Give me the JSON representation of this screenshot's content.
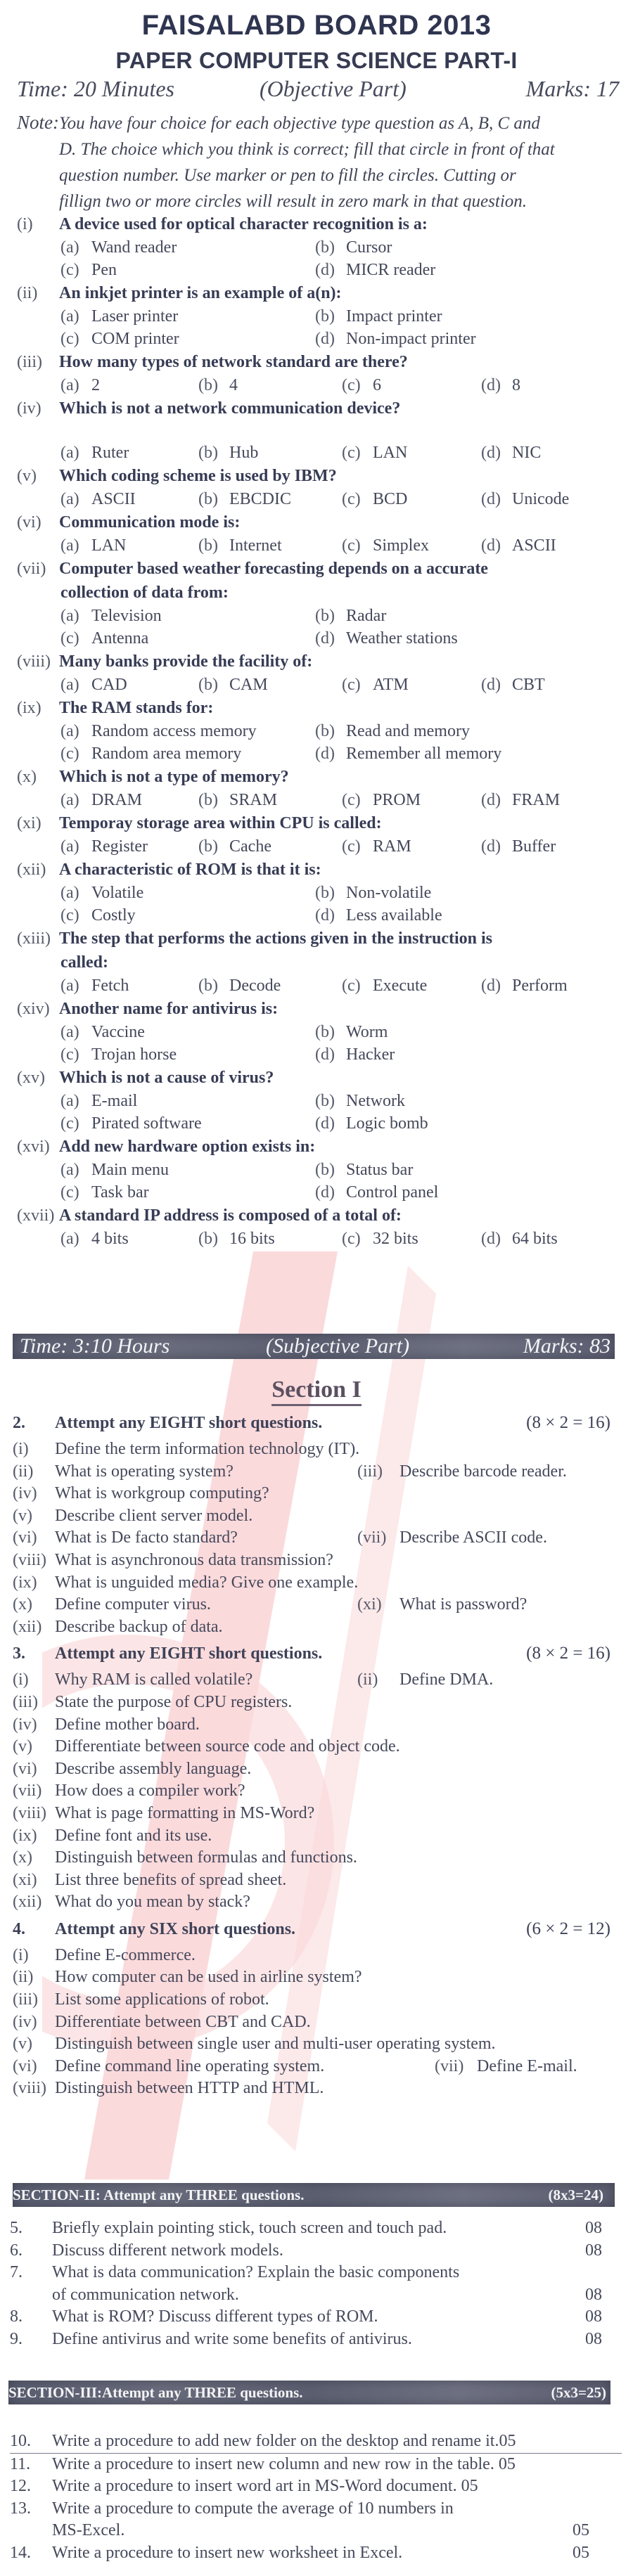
{
  "header": {
    "board": "FAISALABD BOARD 2013",
    "paper": "PAPER COMPUTER SCIENCE PART-I",
    "objective": {
      "time": "Time: 20 Minutes",
      "part": "(Objective Part)",
      "marks": "Marks: 17"
    },
    "note_label": "Note:",
    "note_lines": [
      "You have four choice for each objective type question as A, B, C and",
      "D. The choice which you think is correct; fill that circle in front of that",
      "question number. Use marker or pen to fill the circles. Cutting or",
      "fillign two or more circles will result in zero mark in that question."
    ]
  },
  "mcqs": [
    {
      "num": "(i)",
      "q": [
        "A device used for optical character recognition is a:"
      ],
      "layout": "2col",
      "options": [
        [
          "(a)",
          "Wand reader"
        ],
        [
          "(b)",
          "Cursor"
        ],
        [
          "(c)",
          "Pen"
        ],
        [
          "(d)",
          "MICR reader"
        ]
      ]
    },
    {
      "num": "(ii)",
      "q": [
        "An inkjet printer is an example of a(n):"
      ],
      "layout": "2col",
      "options": [
        [
          "(a)",
          "Laser printer"
        ],
        [
          "(b)",
          "Impact printer"
        ],
        [
          "(c)",
          "COM printer"
        ],
        [
          "(d)",
          "Non-impact printer"
        ]
      ]
    },
    {
      "num": "(iii)",
      "q": [
        "How many types of network standard are there?"
      ],
      "layout": "4col",
      "options": [
        [
          "(a)",
          "2"
        ],
        [
          "(b)",
          "4"
        ],
        [
          "(c)",
          "6"
        ],
        [
          "(d)",
          "8"
        ]
      ]
    },
    {
      "num": "(iv)",
      "q": [
        "Which is not a network communication device?"
      ],
      "layout": "4col",
      "gap": true,
      "options": [
        [
          "(a)",
          "Ruter"
        ],
        [
          "(b)",
          "Hub"
        ],
        [
          "(c)",
          "LAN"
        ],
        [
          "(d)",
          "NIC"
        ]
      ]
    },
    {
      "num": "(v)",
      "q": [
        "Which coding scheme is used by IBM?"
      ],
      "layout": "4col",
      "options": [
        [
          "(a)",
          "ASCII"
        ],
        [
          "(b)",
          "EBCDIC"
        ],
        [
          "(c)",
          "BCD"
        ],
        [
          "(d)",
          "Unicode"
        ]
      ]
    },
    {
      "num": "(vi)",
      "q": [
        "Communication mode is:"
      ],
      "layout": "4col",
      "options": [
        [
          "(a)",
          "LAN"
        ],
        [
          "(b)",
          "Internet"
        ],
        [
          "(c)",
          "Simplex"
        ],
        [
          "(d)",
          "ASCII"
        ]
      ]
    },
    {
      "num": "(vii)",
      "q": [
        "Computer based weather forecasting depends on a accurate",
        "collection of data from:"
      ],
      "layout": "2col",
      "options": [
        [
          "(a)",
          "Television"
        ],
        [
          "(b)",
          "Radar"
        ],
        [
          "(c)",
          "Antenna"
        ],
        [
          "(d)",
          "Weather stations"
        ]
      ]
    },
    {
      "num": "(viii)",
      "q": [
        "Many banks provide the facility of:"
      ],
      "layout": "4col",
      "options": [
        [
          "(a)",
          "CAD"
        ],
        [
          "(b)",
          "CAM"
        ],
        [
          "(c)",
          "ATM"
        ],
        [
          "(d)",
          "CBT"
        ]
      ]
    },
    {
      "num": "(ix)",
      "q": [
        "The RAM stands for:"
      ],
      "layout": "2col",
      "options": [
        [
          "(a)",
          "Random access memory"
        ],
        [
          "(b)",
          "Read and memory"
        ],
        [
          "(c)",
          "Random area memory"
        ],
        [
          "(d)",
          "Remember all memory"
        ]
      ]
    },
    {
      "num": "(x)",
      "q": [
        "Which is not a type of memory?"
      ],
      "layout": "4col",
      "options": [
        [
          "(a)",
          "DRAM"
        ],
        [
          "(b)",
          "SRAM"
        ],
        [
          "(c)",
          "PROM"
        ],
        [
          "(d)",
          "FRAM"
        ]
      ]
    },
    {
      "num": "(xi)",
      "q": [
        "Temporay storage area within CPU is called:"
      ],
      "layout": "4col",
      "options": [
        [
          "(a)",
          "Register"
        ],
        [
          "(b)",
          "Cache"
        ],
        [
          "(c)",
          "RAM"
        ],
        [
          "(d)",
          "Buffer"
        ]
      ]
    },
    {
      "num": "(xii)",
      "q": [
        "A characteristic of ROM is that it is:"
      ],
      "layout": "2col",
      "options": [
        [
          "(a)",
          "Volatile"
        ],
        [
          "(b)",
          "Non-volatile"
        ],
        [
          "(c)",
          "Costly"
        ],
        [
          "(d)",
          "Less available"
        ]
      ]
    },
    {
      "num": "(xiii)",
      "q": [
        "The step that performs the actions given in the instruction is",
        "called:"
      ],
      "layout": "4col",
      "options": [
        [
          "(a)",
          "Fetch"
        ],
        [
          "(b)",
          "Decode"
        ],
        [
          "(c)",
          "Execute"
        ],
        [
          "(d)",
          "Perform"
        ]
      ]
    },
    {
      "num": "(xiv)",
      "q": [
        "Another name for antivirus is:"
      ],
      "layout": "2col",
      "options": [
        [
          "(a)",
          "Vaccine"
        ],
        [
          "(b)",
          "Worm"
        ],
        [
          "(c)",
          "Trojan horse"
        ],
        [
          "(d)",
          "Hacker"
        ]
      ]
    },
    {
      "num": "(xv)",
      "q": [
        "Which is not a cause of virus?"
      ],
      "layout": "2col",
      "options": [
        [
          "(a)",
          "E-mail"
        ],
        [
          "(b)",
          "Network"
        ],
        [
          "(c)",
          "Pirated software"
        ],
        [
          "(d)",
          "Logic bomb"
        ]
      ]
    },
    {
      "num": "(xvi)",
      "q": [
        "Add new hardware option exists in:"
      ],
      "layout": "2col",
      "options": [
        [
          "(a)",
          "Main menu"
        ],
        [
          "(b)",
          "Status bar"
        ],
        [
          "(c)",
          "Task bar"
        ],
        [
          "(d)",
          "Control panel"
        ]
      ]
    },
    {
      "num": "(xvii)",
      "q": [
        "A standard IP address is composed of a total of:"
      ],
      "layout": "4col",
      "options": [
        [
          "(a)",
          "4 bits"
        ],
        [
          "(b)",
          "16 bits"
        ],
        [
          "(c)",
          "32 bits"
        ],
        [
          "(d)",
          "64 bits"
        ]
      ]
    }
  ],
  "subjective": {
    "time": "Time: 3:10 Hours",
    "part": "(Subjective Part)",
    "marks": "Marks: 83",
    "section1_title": "Section I",
    "groups": [
      {
        "num": "2.",
        "title": "Attempt any EIGHT short questions.",
        "marks": "(8 × 2 = 16)",
        "rows": [
          [
            [
              "(i)",
              "Define the term information technology (IT)."
            ]
          ],
          [
            [
              "(ii)",
              "What is operating system?"
            ],
            [
              "(iii)",
              "Describe barcode reader."
            ]
          ],
          [
            [
              "(iv)",
              "What is workgroup computing?"
            ]
          ],
          [
            [
              "(v)",
              "Describe client server model."
            ]
          ],
          [
            [
              "(vi)",
              "What is De facto standard?"
            ],
            [
              "(vii)",
              "Describe ASCII code."
            ]
          ],
          [
            [
              "(viii)",
              "What is asynchronous data transmission?"
            ]
          ],
          [
            [
              "(ix)",
              "What is unguided media? Give one example."
            ]
          ],
          [
            [
              "(x)",
              "Define computer virus."
            ],
            [
              "(xi)",
              "What is password?"
            ]
          ],
          [
            [
              "(xii)",
              "Describe backup of data."
            ]
          ]
        ]
      },
      {
        "num": "3.",
        "title": "Attempt any EIGHT short questions.",
        "marks": "(8 × 2 = 16)",
        "rows": [
          [
            [
              "(i)",
              "Why RAM is called volatile?"
            ],
            [
              "(ii)",
              "Define DMA."
            ]
          ],
          [
            [
              "(iii)",
              "State the purpose of CPU registers."
            ]
          ],
          [
            [
              "(iv)",
              "Define mother board."
            ]
          ],
          [
            [
              "(v)",
              "Differentiate between source code and object code."
            ]
          ],
          [
            [
              "(vi)",
              "Describe assembly language."
            ]
          ],
          [
            [
              "(vii)",
              "How does a compiler work?"
            ]
          ],
          [
            [
              "(viii)",
              "What is page formatting in MS-Word?"
            ]
          ],
          [
            [
              "(ix)",
              "Define font and its use."
            ]
          ],
          [
            [
              "(x)",
              "Distinguish between formulas and functions."
            ]
          ],
          [
            [
              "(xi)",
              "List three benefits of spread sheet."
            ]
          ],
          [
            [
              "(xii)",
              "What do you mean by stack?"
            ]
          ]
        ]
      },
      {
        "num": "4.",
        "title": "Attempt any  SIX  short questions.",
        "marks": "(6 × 2 = 12)",
        "rows": [
          [
            [
              "(i)",
              "Define E-commerce."
            ]
          ],
          [
            [
              "(ii)",
              "How computer can be used in airline system?"
            ]
          ],
          [
            [
              "(iii)",
              "List some applications of robot."
            ]
          ],
          [
            [
              "(iv)",
              "Differentiate between CBT and CAD."
            ]
          ],
          [
            [
              "(v)",
              "Distinguish between single user and multi-user operating system."
            ]
          ],
          [
            [
              "(vi)",
              "Define command line operating system."
            ],
            [
              "(vii)",
              "Define E-mail."
            ]
          ],
          [
            [
              "(viii)",
              "Distinguish between HTTP and HTML."
            ]
          ]
        ]
      }
    ],
    "section2": {
      "title": "SECTION-II: Attempt any THREE questions.",
      "marks": "(8x3=24)",
      "questions": [
        [
          "5.",
          "Briefly explain pointing stick, touch screen and touch pad.",
          "08"
        ],
        [
          "6.",
          "Discuss different network models.",
          "08"
        ],
        [
          "7.",
          "What is data communication? Explain the basic components",
          ""
        ],
        [
          "",
          "of communication network.",
          "08"
        ],
        [
          "8.",
          "What is ROM? Discuss different types of ROM.",
          "08"
        ],
        [
          "9.",
          "Define antivirus and write some benefits of antivirus.",
          "08"
        ]
      ]
    },
    "section3": {
      "title": "SECTION-III:Attempt any THREE questions.",
      "marks": "(5x3=25)",
      "questions": [
        [
          "10.",
          "Write a procedure to add new folder on the desktop and rename it.05",
          ""
        ],
        [
          "11.",
          "Write a procedure to insert new column and new row in the table. 05",
          ""
        ],
        [
          "12.",
          "Write a procedure to insert word art in MS-Word document. 05",
          ""
        ],
        [
          "13.",
          "Write a procedure to compute the average of 10 numbers in",
          ""
        ],
        [
          "",
          "MS-Excel.",
          "05"
        ],
        [
          "14.",
          "Write a procedure to insert new worksheet in Excel.",
          "05"
        ]
      ]
    }
  },
  "colors": {
    "ink": "#3b3f52",
    "bar": "#5f6375",
    "watermark": "#e8202a"
  }
}
